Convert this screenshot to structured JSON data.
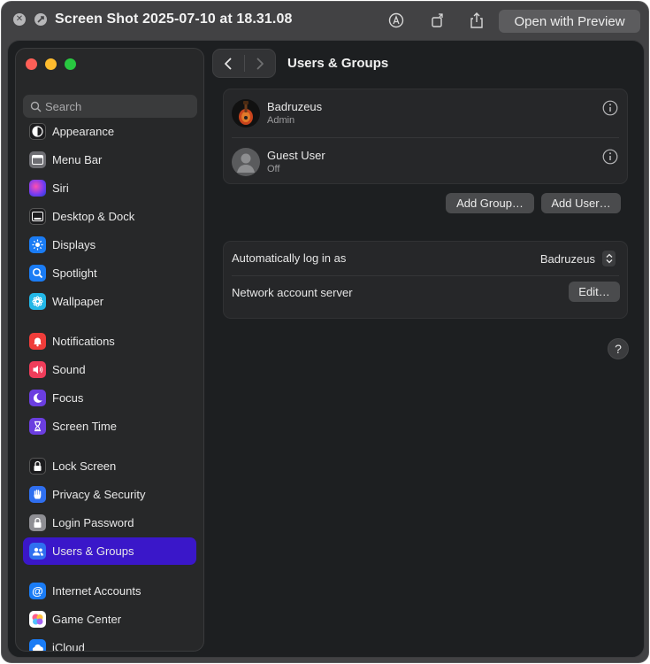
{
  "quicklook": {
    "title": "Screen Shot 2025-07-10 at 18.31.08",
    "open_button": "Open with Preview"
  },
  "sidebar": {
    "search_placeholder": "Search",
    "items": [
      {
        "label": "Appearance",
        "icon": "appearance-icon",
        "color": "#1c1c1e"
      },
      {
        "label": "Menu Bar",
        "icon": "menu-bar-icon",
        "color": "#6e6e73"
      },
      {
        "label": "Siri",
        "icon": "siri-icon",
        "color": "#8a3cf0"
      },
      {
        "label": "Desktop & Dock",
        "icon": "desktop-dock-icon",
        "color": "#1c1c1e"
      },
      {
        "label": "Displays",
        "icon": "displays-icon",
        "color": "#1a7cf5"
      },
      {
        "label": "Spotlight",
        "icon": "spotlight-icon",
        "color": "#1a7cf5"
      },
      {
        "label": "Wallpaper",
        "icon": "wallpaper-icon",
        "color": "#22b8e8"
      },
      {
        "label": "Notifications",
        "icon": "notifications-icon",
        "color": "#ef3d3a"
      },
      {
        "label": "Sound",
        "icon": "sound-icon",
        "color": "#ef3d5a"
      },
      {
        "label": "Focus",
        "icon": "focus-icon",
        "color": "#6b3ee0"
      },
      {
        "label": "Screen Time",
        "icon": "screen-time-icon",
        "color": "#6b3ee0"
      },
      {
        "label": "Lock Screen",
        "icon": "lock-screen-icon",
        "color": "#1c1c1e"
      },
      {
        "label": "Privacy & Security",
        "icon": "privacy-hand-icon",
        "color": "#2f6ff0"
      },
      {
        "label": "Login Password",
        "icon": "login-password-icon",
        "color": "#8e8e93"
      },
      {
        "label": "Users & Groups",
        "icon": "users-groups-icon",
        "color": "#2f6ff0",
        "selected": true
      },
      {
        "label": "Internet Accounts",
        "icon": "internet-accounts-icon",
        "color": "#1a7cf5"
      },
      {
        "label": "Game Center",
        "icon": "game-center-icon",
        "color": "#ffffff"
      },
      {
        "label": "iCloud",
        "icon": "icloud-icon",
        "color": "#1a7cf5"
      }
    ]
  },
  "content": {
    "title": "Users & Groups",
    "users": [
      {
        "name": "Badruzeus",
        "role": "Admin"
      },
      {
        "name": "Guest User",
        "role": "Off"
      }
    ],
    "add_group": "Add Group…",
    "add_user": "Add User…",
    "auto_login_label": "Automatically log in as",
    "auto_login_value": "Badruzeus",
    "network_server_label": "Network account server",
    "edit_button": "Edit…",
    "help": "?"
  },
  "colors": {
    "selection": "#3a17c9",
    "window_bg": "#1d1f21",
    "sidebar_bg": "#272829"
  }
}
